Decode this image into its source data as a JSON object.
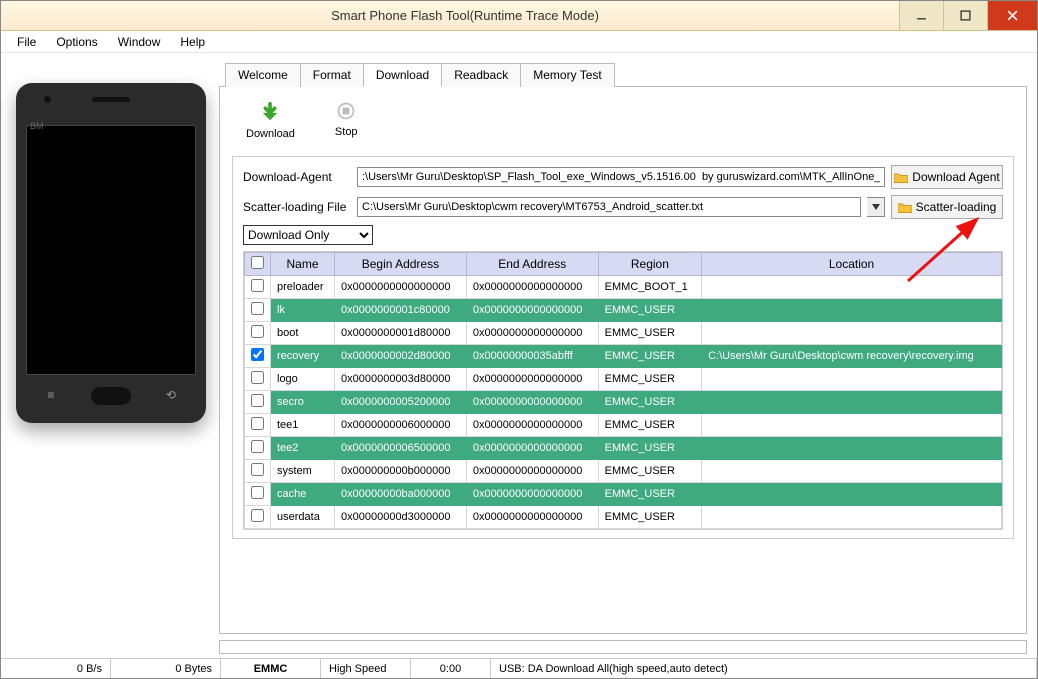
{
  "window": {
    "title": "Smart Phone Flash Tool(Runtime Trace Mode)"
  },
  "menu": [
    "File",
    "Options",
    "Window",
    "Help"
  ],
  "phone_brand": "BM",
  "tabs": [
    "Welcome",
    "Format",
    "Download",
    "Readback",
    "Memory Test"
  ],
  "active_tab": "Download",
  "toolbar": {
    "download": "Download",
    "stop": "Stop"
  },
  "config": {
    "da_label": "Download-Agent",
    "da_path": ":\\Users\\Mr Guru\\Desktop\\SP_Flash_Tool_exe_Windows_v5.1516.00  by guruswizard.com\\MTK_AllInOne_DA.bin",
    "da_button": "Download Agent",
    "scatter_label": "Scatter-loading File",
    "scatter_path": "C:\\Users\\Mr Guru\\Desktop\\cwm recovery\\MT6753_Android_scatter.txt",
    "scatter_button": "Scatter-loading",
    "mode": "Download Only"
  },
  "columns": [
    "",
    "Name",
    "Begin Address",
    "End Address",
    "Region",
    "Location"
  ],
  "rows": [
    {
      "checked": false,
      "green": false,
      "name": "preloader",
      "begin": "0x0000000000000000",
      "end": "0x0000000000000000",
      "region": "EMMC_BOOT_1",
      "location": ""
    },
    {
      "checked": false,
      "green": true,
      "name": "lk",
      "begin": "0x0000000001c80000",
      "end": "0x0000000000000000",
      "region": "EMMC_USER",
      "location": ""
    },
    {
      "checked": false,
      "green": false,
      "name": "boot",
      "begin": "0x0000000001d80000",
      "end": "0x0000000000000000",
      "region": "EMMC_USER",
      "location": ""
    },
    {
      "checked": true,
      "green": true,
      "name": "recovery",
      "begin": "0x0000000002d80000",
      "end": "0x00000000035abfff",
      "region": "EMMC_USER",
      "location": "C:\\Users\\Mr Guru\\Desktop\\cwm recovery\\recovery.img"
    },
    {
      "checked": false,
      "green": false,
      "name": "logo",
      "begin": "0x0000000003d80000",
      "end": "0x0000000000000000",
      "region": "EMMC_USER",
      "location": ""
    },
    {
      "checked": false,
      "green": true,
      "name": "secro",
      "begin": "0x0000000005200000",
      "end": "0x0000000000000000",
      "region": "EMMC_USER",
      "location": ""
    },
    {
      "checked": false,
      "green": false,
      "name": "tee1",
      "begin": "0x0000000006000000",
      "end": "0x0000000000000000",
      "region": "EMMC_USER",
      "location": ""
    },
    {
      "checked": false,
      "green": true,
      "name": "tee2",
      "begin": "0x0000000006500000",
      "end": "0x0000000000000000",
      "region": "EMMC_USER",
      "location": ""
    },
    {
      "checked": false,
      "green": false,
      "name": "system",
      "begin": "0x000000000b000000",
      "end": "0x0000000000000000",
      "region": "EMMC_USER",
      "location": ""
    },
    {
      "checked": false,
      "green": true,
      "name": "cache",
      "begin": "0x00000000ba000000",
      "end": "0x0000000000000000",
      "region": "EMMC_USER",
      "location": ""
    },
    {
      "checked": false,
      "green": false,
      "name": "userdata",
      "begin": "0x00000000d3000000",
      "end": "0x0000000000000000",
      "region": "EMMC_USER",
      "location": ""
    }
  ],
  "status": {
    "speed": "0 B/s",
    "bytes": "0 Bytes",
    "storage": "EMMC",
    "mode": "High Speed",
    "time": "0:00",
    "usb": "USB: DA Download All(high speed,auto detect)"
  }
}
